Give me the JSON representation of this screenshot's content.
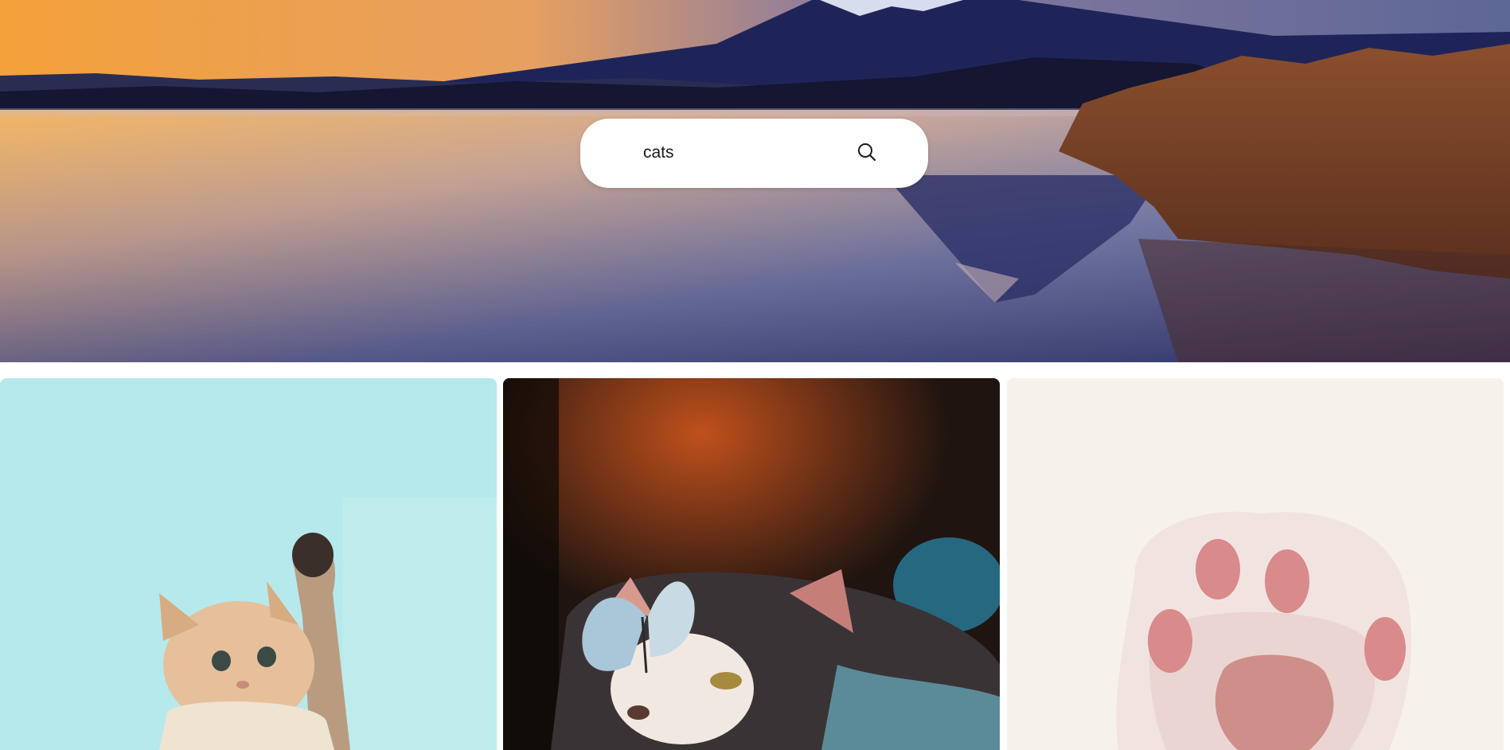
{
  "search": {
    "value": "cats",
    "placeholder": "",
    "icon": "search-icon"
  },
  "hero": {
    "image": "mountain-lake-sunset"
  },
  "gallery": {
    "images": [
      {
        "subject": "kitten-reaching-paw",
        "bg_color": "#b3e8ea"
      },
      {
        "subject": "cat-with-butterfly",
        "bg_color": "#1f1410"
      },
      {
        "subject": "cat-paw-pads",
        "bg_color": "#f6f0ea"
      }
    ]
  },
  "colors": {
    "page_background": "#ffffff",
    "search_background": "#ffffff"
  }
}
